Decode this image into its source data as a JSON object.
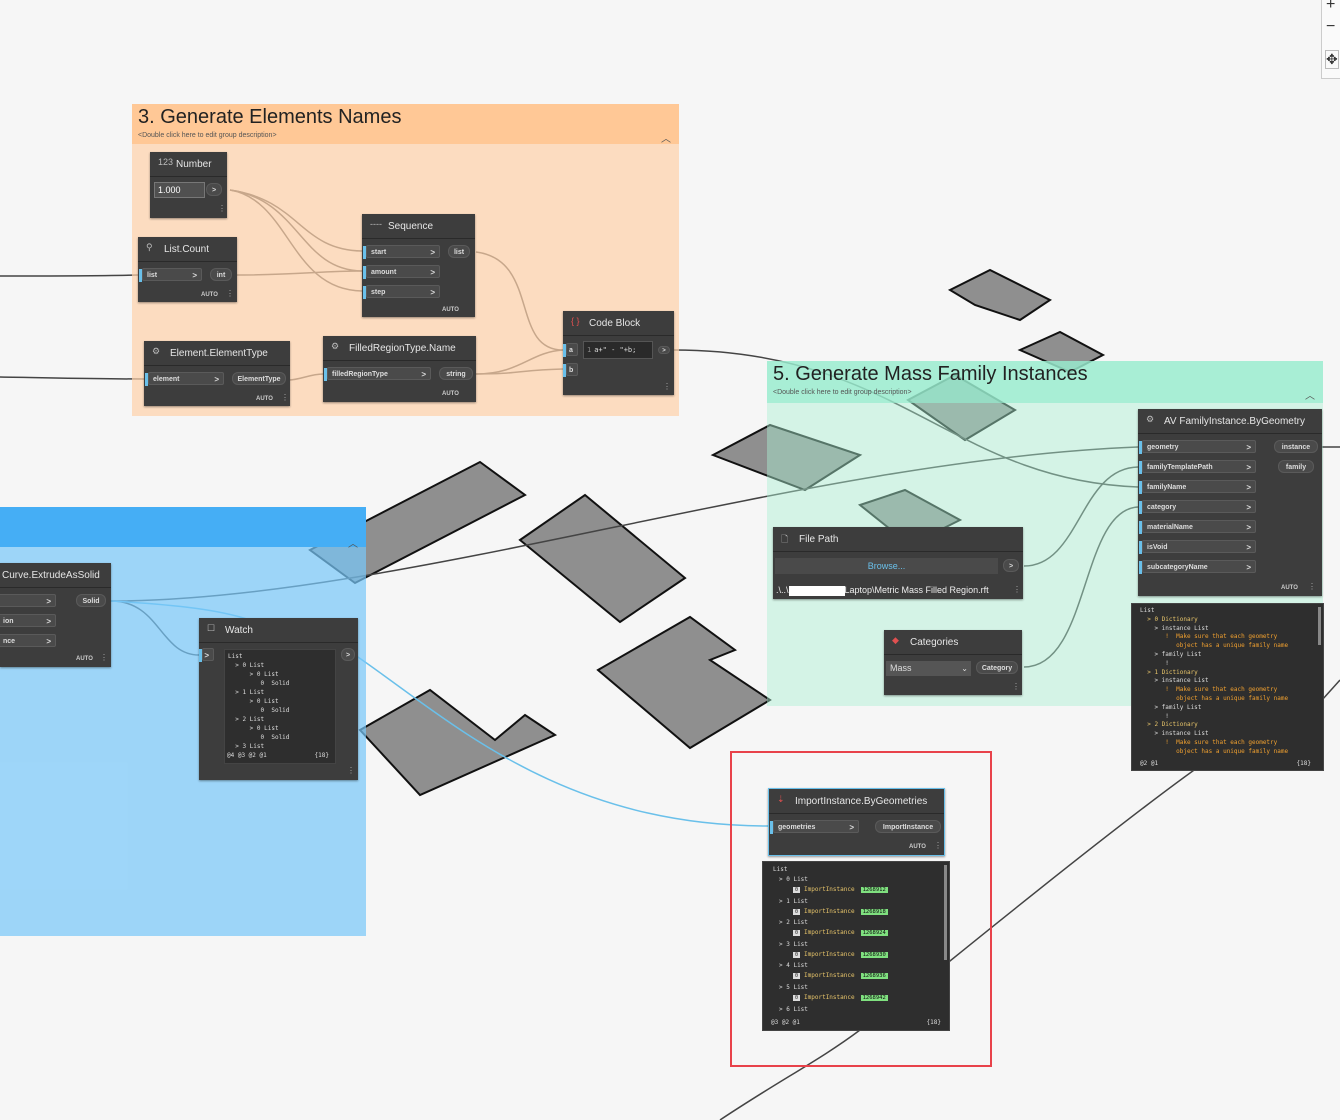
{
  "canvas_controls": {
    "zoom_in": "+",
    "zoom_out": "−",
    "fit": "✥"
  },
  "groups": {
    "g3": {
      "title": "3. Generate Elements Names",
      "desc": "<Double click here to edit group description>",
      "collapse": "︿"
    },
    "g5": {
      "title": "5. Generate Mass Family Instances",
      "desc": "<Double click here to edit group description>",
      "collapse": "︿"
    },
    "blue": {
      "collapse": "︿"
    }
  },
  "nodes": {
    "number": {
      "title": "Number",
      "value": "1.000",
      "out": ">"
    },
    "list_count": {
      "title": "List.Count",
      "in": [
        "list"
      ],
      "out": "int",
      "auto": "AUTO"
    },
    "sequence": {
      "title": "Sequence",
      "in": [
        "start",
        "amount",
        "step"
      ],
      "out": "list",
      "auto": "AUTO"
    },
    "element_type": {
      "title": "Element.ElementType",
      "in": [
        "element"
      ],
      "out": "ElementType",
      "auto": "AUTO"
    },
    "filled_region_name": {
      "title": "FilledRegionType.Name",
      "in": [
        "filledRegionType"
      ],
      "out": "string",
      "auto": "AUTO"
    },
    "code_block": {
      "title": "Code Block",
      "in": [
        "a",
        "b"
      ],
      "code": "a+\" - \"+b;",
      "line": "1",
      "out": ">"
    },
    "curve_extrude": {
      "title": "Curve.ExtrudeAsSolid",
      "out": "Solid",
      "in_partial": [
        "",
        "ion",
        "nce"
      ],
      "auto": "AUTO"
    },
    "watch": {
      "title": "Watch",
      "footer_left": "@4 @3 @2 @1",
      "footer_right": "{18}",
      "lines": [
        "List",
        "  > 0 List",
        "      > 0 List",
        "         0  Solid",
        "  > 1 List",
        "      > 0 List",
        "         0  Solid",
        "  > 2 List",
        "      > 0 List",
        "         0  Solid",
        "  > 3 List"
      ]
    },
    "family_instance": {
      "title": "AV FamilyInstance.ByGeometry",
      "in": [
        "geometry",
        "familyTemplatePath",
        "familyName",
        "category",
        "materialName",
        "isVoid",
        "subcategoryName"
      ],
      "out": [
        "instance",
        "family"
      ],
      "auto": "AUTO"
    },
    "file_path": {
      "title": "File Path",
      "browse": "Browse...",
      "path_prefix": ".\\..\\",
      "path_suffix": "Laptop\\Metric Mass Filled Region.rft",
      "out": ">"
    },
    "categories": {
      "title": "Categories",
      "selected": "Mass",
      "out": "Category"
    },
    "import_instance": {
      "title": "ImportInstance.ByGeometries",
      "in": [
        "geometries"
      ],
      "out": "ImportInstance",
      "auto": "AUTO"
    }
  },
  "family_preview": {
    "footer_left": "@2 @1",
    "footer_right": "{18}",
    "lines": [
      {
        "t": "List"
      },
      {
        "t": "  > 0 Dictionary",
        "c": "key"
      },
      {
        "t": "    > instance List"
      },
      {
        "t": "       !  Make sure that each geometry",
        "c": "warn"
      },
      {
        "t": "          object has a unique family name",
        "c": "warn"
      },
      {
        "t": "    > family List"
      },
      {
        "t": "       !"
      },
      {
        "t": "  > 1 Dictionary",
        "c": "key"
      },
      {
        "t": "    > instance List"
      },
      {
        "t": "       !  Make sure that each geometry",
        "c": "warn"
      },
      {
        "t": "          object has a unique family name",
        "c": "warn"
      },
      {
        "t": "    > family List"
      },
      {
        "t": "       !"
      },
      {
        "t": "  > 2 Dictionary",
        "c": "key"
      },
      {
        "t": "    > instance List"
      },
      {
        "t": "       !  Make sure that each geometry",
        "c": "warn"
      },
      {
        "t": "          object has a unique family name",
        "c": "warn"
      }
    ]
  },
  "import_preview": {
    "footer_left": "@3 @2 @1",
    "footer_right": "{18}",
    "header": "List",
    "items": [
      {
        "list": "0 List",
        "label": "ImportInstance",
        "id": "1268912"
      },
      {
        "list": "1 List",
        "label": "ImportInstance",
        "id": "1268918"
      },
      {
        "list": "2 List",
        "label": "ImportInstance",
        "id": "1268924"
      },
      {
        "list": "3 List",
        "label": "ImportInstance",
        "id": "1268930"
      },
      {
        "list": "4 List",
        "label": "ImportInstance",
        "id": "1268936"
      },
      {
        "list": "5 List",
        "label": "ImportInstance",
        "id": "1268942"
      }
    ],
    "tail": "6 List"
  },
  "colors": {
    "highlight": "#e8424a",
    "group3": "#ffd9b8",
    "group5": "#b3f0d8",
    "blue_group": "#9ad4f8",
    "port_bar": "#6ac0ea"
  }
}
